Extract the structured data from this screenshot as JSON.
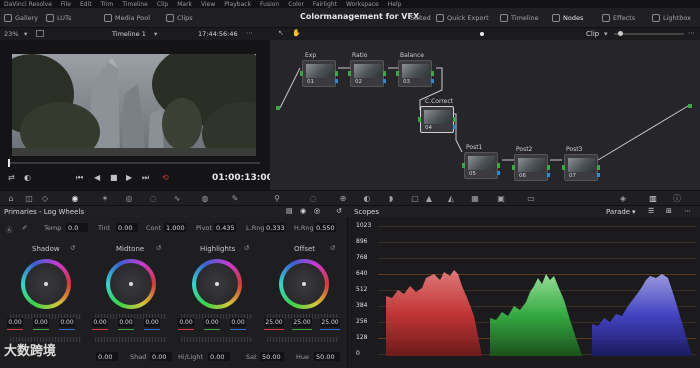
{
  "menubar": [
    "DaVinci Resolve",
    "File",
    "Edit",
    "Trim",
    "Timeline",
    "Clip",
    "Mark",
    "View",
    "Playback",
    "Fusion",
    "Color",
    "Fairlight",
    "Workspace",
    "Help"
  ],
  "pagebar": {
    "left": [
      {
        "label": "Gallery",
        "icon": "gallery-icon"
      },
      {
        "label": "LUTs",
        "icon": "luts-icon"
      },
      {
        "label": "Media Pool",
        "icon": "media-pool-icon"
      },
      {
        "label": "Clips",
        "icon": "clips-icon"
      }
    ],
    "project_title": "Colormanagement for VFX",
    "center": [
      {
        "label": "Edited"
      },
      {
        "label": "Quick Export",
        "icon": "export-icon"
      }
    ],
    "right": [
      {
        "label": "Timeline",
        "icon": "timeline-icon"
      },
      {
        "label": "Nodes",
        "icon": "nodes-icon"
      },
      {
        "label": "Effects",
        "icon": "effects-icon"
      },
      {
        "label": "Lightbox",
        "icon": "lightbox-icon"
      }
    ]
  },
  "viewer": {
    "zoom": "23%",
    "timeline_name": "Timeline 1",
    "source_timecode": "17:44:56:46",
    "timecode": "01:00:13:00",
    "node_mode": "Clip"
  },
  "nodes": [
    {
      "label": "Exp",
      "num": "01"
    },
    {
      "label": "Ratio",
      "num": "02"
    },
    {
      "label": "Balance",
      "num": "03"
    },
    {
      "label": "C.Correct",
      "num": "04"
    },
    {
      "label": "Post1",
      "num": "05"
    },
    {
      "label": "Post2",
      "num": "06"
    },
    {
      "label": "Post3",
      "num": "07"
    }
  ],
  "primaries": {
    "title": "Primaries - Log Wheels",
    "temp_label": "Temp",
    "temp_value": "0.0",
    "tint_label": "Tint",
    "tint_value": "0.00",
    "cont_label": "Cont",
    "cont_value": "1.000",
    "pivot_label": "Pivot",
    "pivot_value": "0.435",
    "lrng_label": "L.Rng",
    "lrng_value": "0.333",
    "hrng_label": "H.Rng",
    "hrng_value": "0.550",
    "wheels": [
      {
        "title": "Shadow",
        "values": [
          "0.00",
          "0.00",
          "0.00"
        ]
      },
      {
        "title": "Midtone",
        "values": [
          "0.00",
          "0.00",
          "0.00"
        ]
      },
      {
        "title": "Highlights",
        "values": [
          "0.00",
          "0.00",
          "0.00"
        ]
      },
      {
        "title": "Offset",
        "values": [
          "25.00",
          "25.00",
          "25.00"
        ]
      }
    ],
    "bottom": {
      "mid_value": "0.00",
      "shad_label": "Shad",
      "shad_value": "0.00",
      "hl_label": "Hi/Light",
      "hl_value": "0.00",
      "sat_label": "Sat",
      "sat_value": "50.00",
      "hue_label": "Hue",
      "hue_value": "50.00"
    }
  },
  "scopes": {
    "title": "Scopes",
    "mode": "Parade",
    "ticks": [
      "1023",
      "896",
      "768",
      "640",
      "512",
      "384",
      "256",
      "128",
      "0"
    ]
  },
  "watermark": "大数跨境",
  "colors": {
    "accent": "#d33b3b",
    "pin_green": "#3ea644",
    "pin_blue": "#2f8bd6",
    "parade_red": "#ff5a5a",
    "parade_green": "#55e060",
    "parade_blue": "#6a6aff"
  }
}
